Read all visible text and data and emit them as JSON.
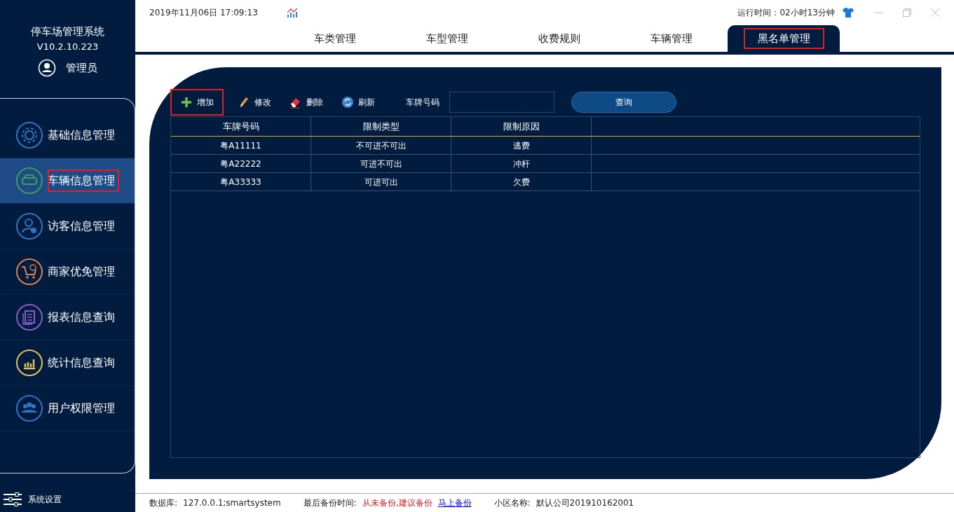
{
  "app": {
    "title": "停车场管理系统",
    "version": "V10.2.10.223",
    "user": "管理员"
  },
  "sidebar": {
    "items": [
      {
        "label": "基础信息管理",
        "selected": false,
        "highlighted": false
      },
      {
        "label": "车辆信息管理",
        "selected": true,
        "highlighted": true
      },
      {
        "label": "访客信息管理",
        "selected": false,
        "highlighted": false
      },
      {
        "label": "商家优免管理",
        "selected": false,
        "highlighted": false
      },
      {
        "label": "报表信息查询",
        "selected": false,
        "highlighted": false
      },
      {
        "label": "统计信息查询",
        "selected": false,
        "highlighted": false
      },
      {
        "label": "用户权限管理",
        "selected": false,
        "highlighted": false
      }
    ],
    "settings": "系统设置"
  },
  "header": {
    "datetime": "2019年11月06日 17:09:13",
    "runtime": "运行时间：02小时13分钟"
  },
  "tabs": [
    {
      "label": "车类管理",
      "selected": false,
      "highlighted": false
    },
    {
      "label": "车型管理",
      "selected": false,
      "highlighted": false
    },
    {
      "label": "收费规则",
      "selected": false,
      "highlighted": false
    },
    {
      "label": "车辆管理",
      "selected": false,
      "highlighted": false
    },
    {
      "label": "黑名单管理",
      "selected": true,
      "highlighted": true
    }
  ],
  "toolbar": {
    "buttons": [
      {
        "label": "增加",
        "kind": "add",
        "highlighted": true
      },
      {
        "label": "修改",
        "kind": "edit",
        "highlighted": false
      },
      {
        "label": "删除",
        "kind": "delete",
        "highlighted": false
      },
      {
        "label": "刷新",
        "kind": "refresh",
        "highlighted": false
      }
    ],
    "search_label": "车牌号码",
    "search_button": "查询"
  },
  "table": {
    "columns": [
      "车牌号码",
      "限制类型",
      "限制原因"
    ],
    "rows": [
      [
        "粤A11111",
        "不可进不可出",
        "逃费"
      ],
      [
        "粤A22222",
        "可进不可出",
        "冲杆"
      ],
      [
        "粤A33333",
        "可进可出",
        "欠费"
      ]
    ]
  },
  "status_bar": {
    "db_label": "数据库:",
    "db_value": "127.0.0.1;smartsystem",
    "backup_label": "最后备份时间:",
    "backup_value": "从未备份,建议备份",
    "backup_link": "马上备份",
    "area_label": "小区名称:",
    "area_value": "默认公司201910162001"
  }
}
